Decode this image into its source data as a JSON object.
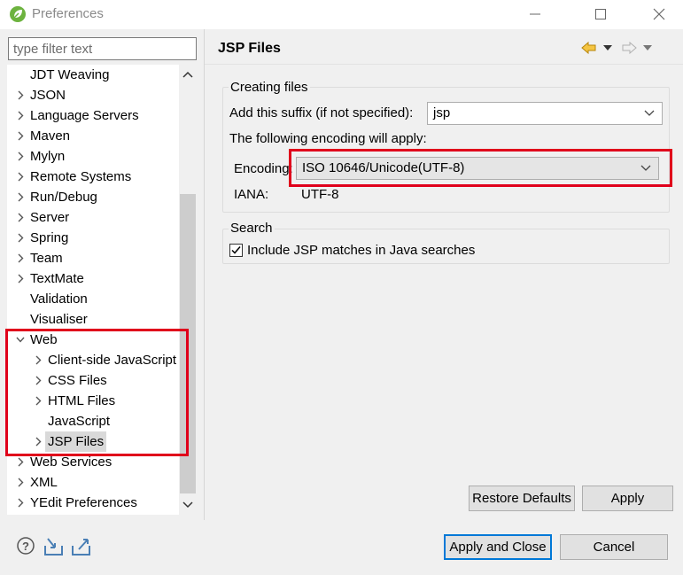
{
  "window": {
    "title": "Preferences",
    "minimize_icon": "minimize-icon",
    "maximize_icon": "maximize-icon",
    "close_icon": "close-icon"
  },
  "filter": {
    "placeholder": "type filter text",
    "value": ""
  },
  "tree": {
    "items": [
      {
        "label": "JDT Weaving",
        "level": 0,
        "expander": "none"
      },
      {
        "label": "JSON",
        "level": 0,
        "expander": "collapsed"
      },
      {
        "label": "Language Servers",
        "level": 0,
        "expander": "collapsed"
      },
      {
        "label": "Maven",
        "level": 0,
        "expander": "collapsed"
      },
      {
        "label": "Mylyn",
        "level": 0,
        "expander": "collapsed"
      },
      {
        "label": "Remote Systems",
        "level": 0,
        "expander": "collapsed"
      },
      {
        "label": "Run/Debug",
        "level": 0,
        "expander": "collapsed"
      },
      {
        "label": "Server",
        "level": 0,
        "expander": "collapsed"
      },
      {
        "label": "Spring",
        "level": 0,
        "expander": "collapsed"
      },
      {
        "label": "Team",
        "level": 0,
        "expander": "collapsed"
      },
      {
        "label": "TextMate",
        "level": 0,
        "expander": "collapsed"
      },
      {
        "label": "Validation",
        "level": 0,
        "expander": "none"
      },
      {
        "label": "Visualiser",
        "level": 0,
        "expander": "none"
      },
      {
        "label": "Web",
        "level": 0,
        "expander": "expanded"
      },
      {
        "label": "Client-side JavaScript",
        "level": 1,
        "expander": "collapsed"
      },
      {
        "label": "CSS Files",
        "level": 1,
        "expander": "collapsed"
      },
      {
        "label": "HTML Files",
        "level": 1,
        "expander": "collapsed"
      },
      {
        "label": "JavaScript",
        "level": 1,
        "expander": "none"
      },
      {
        "label": "JSP Files",
        "level": 1,
        "expander": "collapsed",
        "selected": true
      },
      {
        "label": "Web Services",
        "level": 0,
        "expander": "collapsed"
      },
      {
        "label": "XML",
        "level": 0,
        "expander": "collapsed"
      },
      {
        "label": "YEdit Preferences",
        "level": 0,
        "expander": "collapsed"
      }
    ]
  },
  "page": {
    "title": "JSP Files",
    "back_icon": "back-arrow-icon",
    "forward_icon": "forward-arrow-icon"
  },
  "creating_files": {
    "group_label": "Creating files",
    "suffix_label": "Add this suffix (if not specified):",
    "suffix_value": "jsp",
    "encoding_note": "The following encoding will apply:",
    "encoding_label": "Encoding:",
    "encoding_value": "ISO 10646/Unicode(UTF-8)",
    "iana_label": "IANA:",
    "iana_value": "UTF-8"
  },
  "search": {
    "group_label": "Search",
    "include_label": "Include JSP matches in Java searches",
    "include_checked": true
  },
  "buttons": {
    "restore_defaults": "Restore Defaults",
    "apply": "Apply",
    "apply_and_close": "Apply and Close",
    "cancel": "Cancel"
  },
  "footer": {
    "help_icon": "help-icon",
    "import_icon": "import-icon",
    "export_icon": "export-icon"
  },
  "colors": {
    "highlight_box": "#e0001b",
    "default_button_border": "#0078d7",
    "selection": "#d9d9d9"
  }
}
